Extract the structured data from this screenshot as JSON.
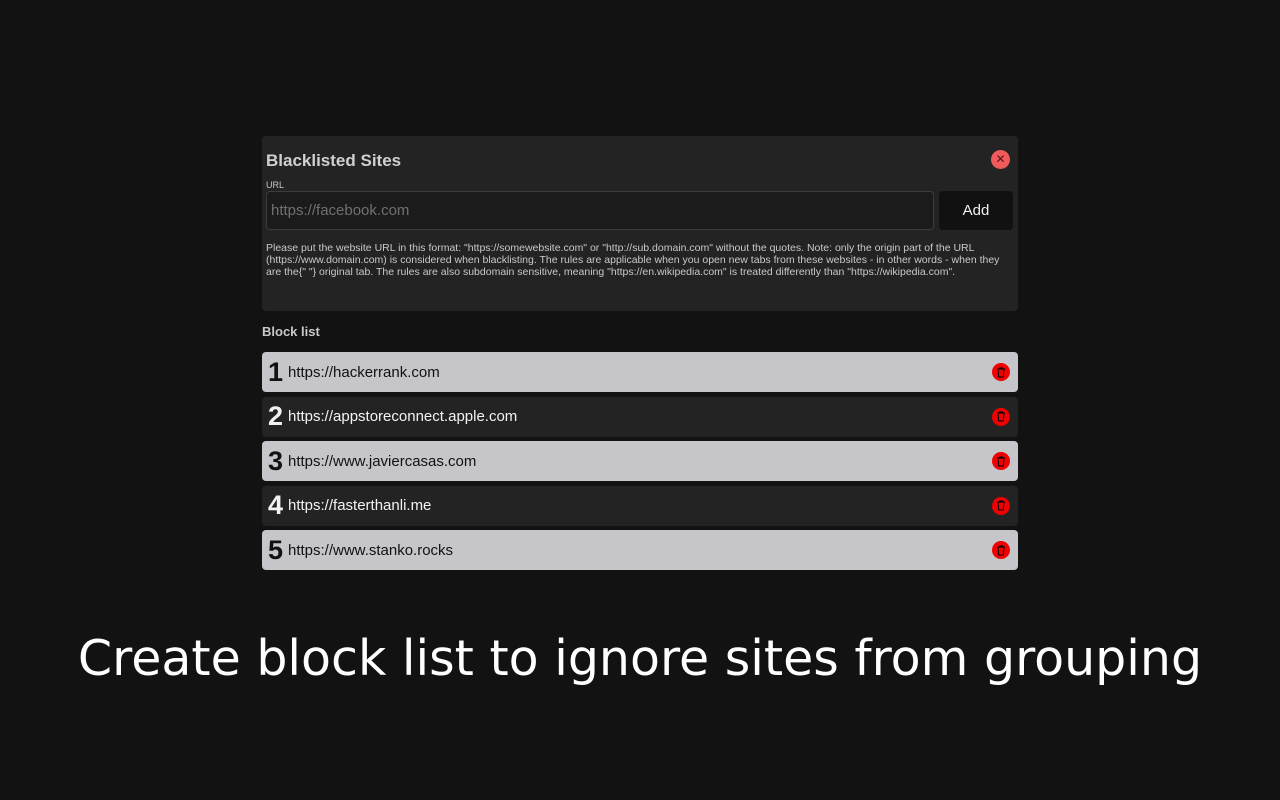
{
  "panel": {
    "title": "Blacklisted Sites",
    "close_label": "✕",
    "url_label": "URL",
    "url_placeholder": "https://facebook.com",
    "add_label": "Add",
    "help_text": "Please put the website URL in this format: \"https://somewebsite.com\" or \"http://sub.domain.com\" without the quotes. Note: only the origin part of the URL (https://www.domain.com) is considered when blacklisting. The rules are applicable when you open new tabs from these websites - in other words - when they are the{\" \"} original tab. The rules are also subdomain sensitive, meaning \"https://en.wikipedia.com\" is treated differently than \"https://wikipedia.com\"."
  },
  "block_list": {
    "title": "Block list",
    "items": [
      {
        "num": "1",
        "url": "https://hackerrank.com"
      },
      {
        "num": "2",
        "url": "https://appstoreconnect.apple.com"
      },
      {
        "num": "3",
        "url": "https://www.javiercasas.com"
      },
      {
        "num": "4",
        "url": "https://fasterthanli.me"
      },
      {
        "num": "5",
        "url": "https://www.stanko.rocks"
      }
    ]
  },
  "caption": "Create block list to ignore sites from grouping",
  "colors": {
    "background": "#121212",
    "panel": "#232323",
    "row_light": "#c6c6ca",
    "delete": "#f00000",
    "close": "#f05a5a"
  }
}
